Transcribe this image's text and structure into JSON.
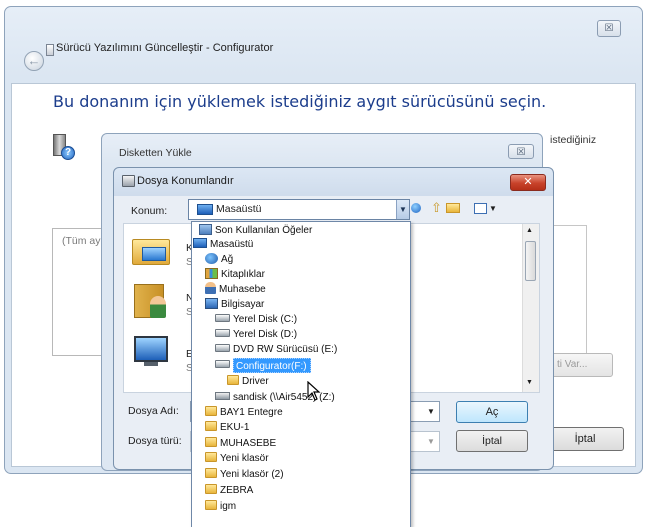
{
  "outer_window": {
    "title": "Sürücü Yazılımını Güncelleştir - Configurator",
    "close_label": "☒",
    "heading": "Bu donanım için yüklemek istediğiniz aygıt sürücüsünü seçin.",
    "partial_text": "istediğiniz",
    "list_placeholder": "(Tüm ay",
    "disk_button": "ti Var...",
    "cancel_label": "İptal"
  },
  "disk_dialog": {
    "title": "Disketten Yükle",
    "close_label": "☒"
  },
  "file_dialog": {
    "title": "Dosya Konumlandır",
    "close_label": "✕",
    "location_label": "Konum:",
    "location_value": "Masaüstü",
    "filename_label": "Dosya Adı:",
    "filetype_label": "Dosya türü:",
    "open_label": "Aç",
    "cancel_label": "İptal",
    "places_partial": [
      "K",
      "S",
      "N",
      "S",
      "E",
      "S"
    ]
  },
  "dropdown": {
    "items": [
      {
        "label": "Son Kullanılan Öğeler",
        "icon": "recent-items-icon"
      },
      {
        "label": "Masaüstü",
        "icon": "desktop-icon"
      },
      {
        "label": "Ağ",
        "icon": "network-icon"
      },
      {
        "label": "Kitaplıklar",
        "icon": "libraries-icon"
      },
      {
        "label": "Muhasebe",
        "icon": "user-folder-icon"
      },
      {
        "label": "Bilgisayar",
        "icon": "computer-icon"
      },
      {
        "label": "Yerel Disk (C:)",
        "icon": "local-disk-icon"
      },
      {
        "label": "Yerel Disk (D:)",
        "icon": "local-disk-icon"
      },
      {
        "label": "DVD RW Sürücüsü (E:)",
        "icon": "dvd-drive-icon"
      },
      {
        "label": "Configurator(F:)",
        "icon": "removable-drive-icon",
        "selected": true
      },
      {
        "label": "Driver",
        "icon": "folder-icon"
      },
      {
        "label": "sandisk (\\\\Air5452) (Z:)",
        "icon": "network-drive-icon"
      },
      {
        "label": "BAY1 Entegre",
        "icon": "folder-icon"
      },
      {
        "label": "EKU-1",
        "icon": "folder-icon"
      },
      {
        "label": "MUHASEBE",
        "icon": "folder-icon"
      },
      {
        "label": "Yeni klasör",
        "icon": "folder-icon"
      },
      {
        "label": "Yeni klasör (2)",
        "icon": "folder-icon"
      },
      {
        "label": "ZEBRA",
        "icon": "folder-icon"
      },
      {
        "label": "igm",
        "icon": "folder-icon"
      }
    ]
  },
  "colors": {
    "heading": "#1c3d8c",
    "selection": "#3399ff",
    "close_red": "#c8422a"
  }
}
